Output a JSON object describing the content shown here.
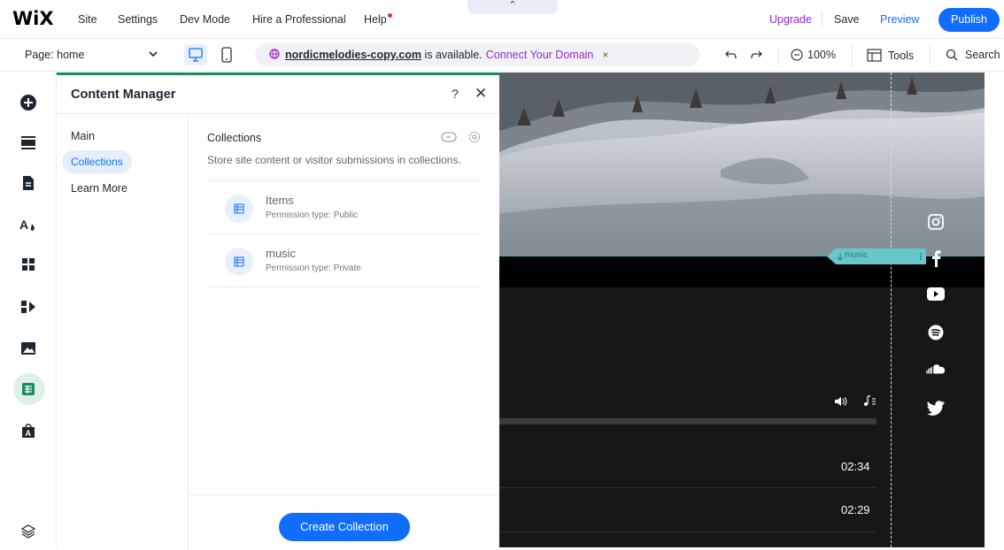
{
  "topbar": {
    "logo": "WiX",
    "menu": [
      "Site",
      "Settings",
      "Dev Mode",
      "Hire a Professional",
      "Help"
    ],
    "collapse_glyph": "⌃",
    "upgrade": "Upgrade",
    "save": "Save",
    "preview": "Preview",
    "publish": "Publish"
  },
  "toolbar": {
    "page_prefix": "Page:",
    "page_name": "home",
    "domain": "nordicmelodies-copy.com",
    "domain_suffix": " is available.",
    "connect": "Connect Your Domain",
    "dismiss": "×",
    "zoom": "100%",
    "tools": "Tools",
    "search": "Search"
  },
  "panel": {
    "title": "Content Manager",
    "help": "?",
    "close": "✕",
    "nav": [
      "Main",
      "Collections",
      "Learn More"
    ],
    "active_nav": "Collections",
    "collections_title": "Collections",
    "collections_desc": "Store site content or visitor submissions in collections.",
    "collections": [
      {
        "name": "Items",
        "permission": "Permission type: Public"
      },
      {
        "name": "music",
        "permission": "Permission type: Private"
      }
    ],
    "create_button": "Create Collection"
  },
  "canvas": {
    "anchor_label": "music",
    "times": [
      "02:34",
      "02:29"
    ],
    "social_icons": [
      "instagram-icon",
      "facebook-icon",
      "youtube-icon",
      "spotify-icon",
      "soundcloud-icon",
      "twitter-icon"
    ]
  },
  "colors": {
    "accent": "#116dff",
    "upgrade": "#9a27d5",
    "panel_border": "#1d8a5a",
    "teal": "#38c2c9"
  }
}
